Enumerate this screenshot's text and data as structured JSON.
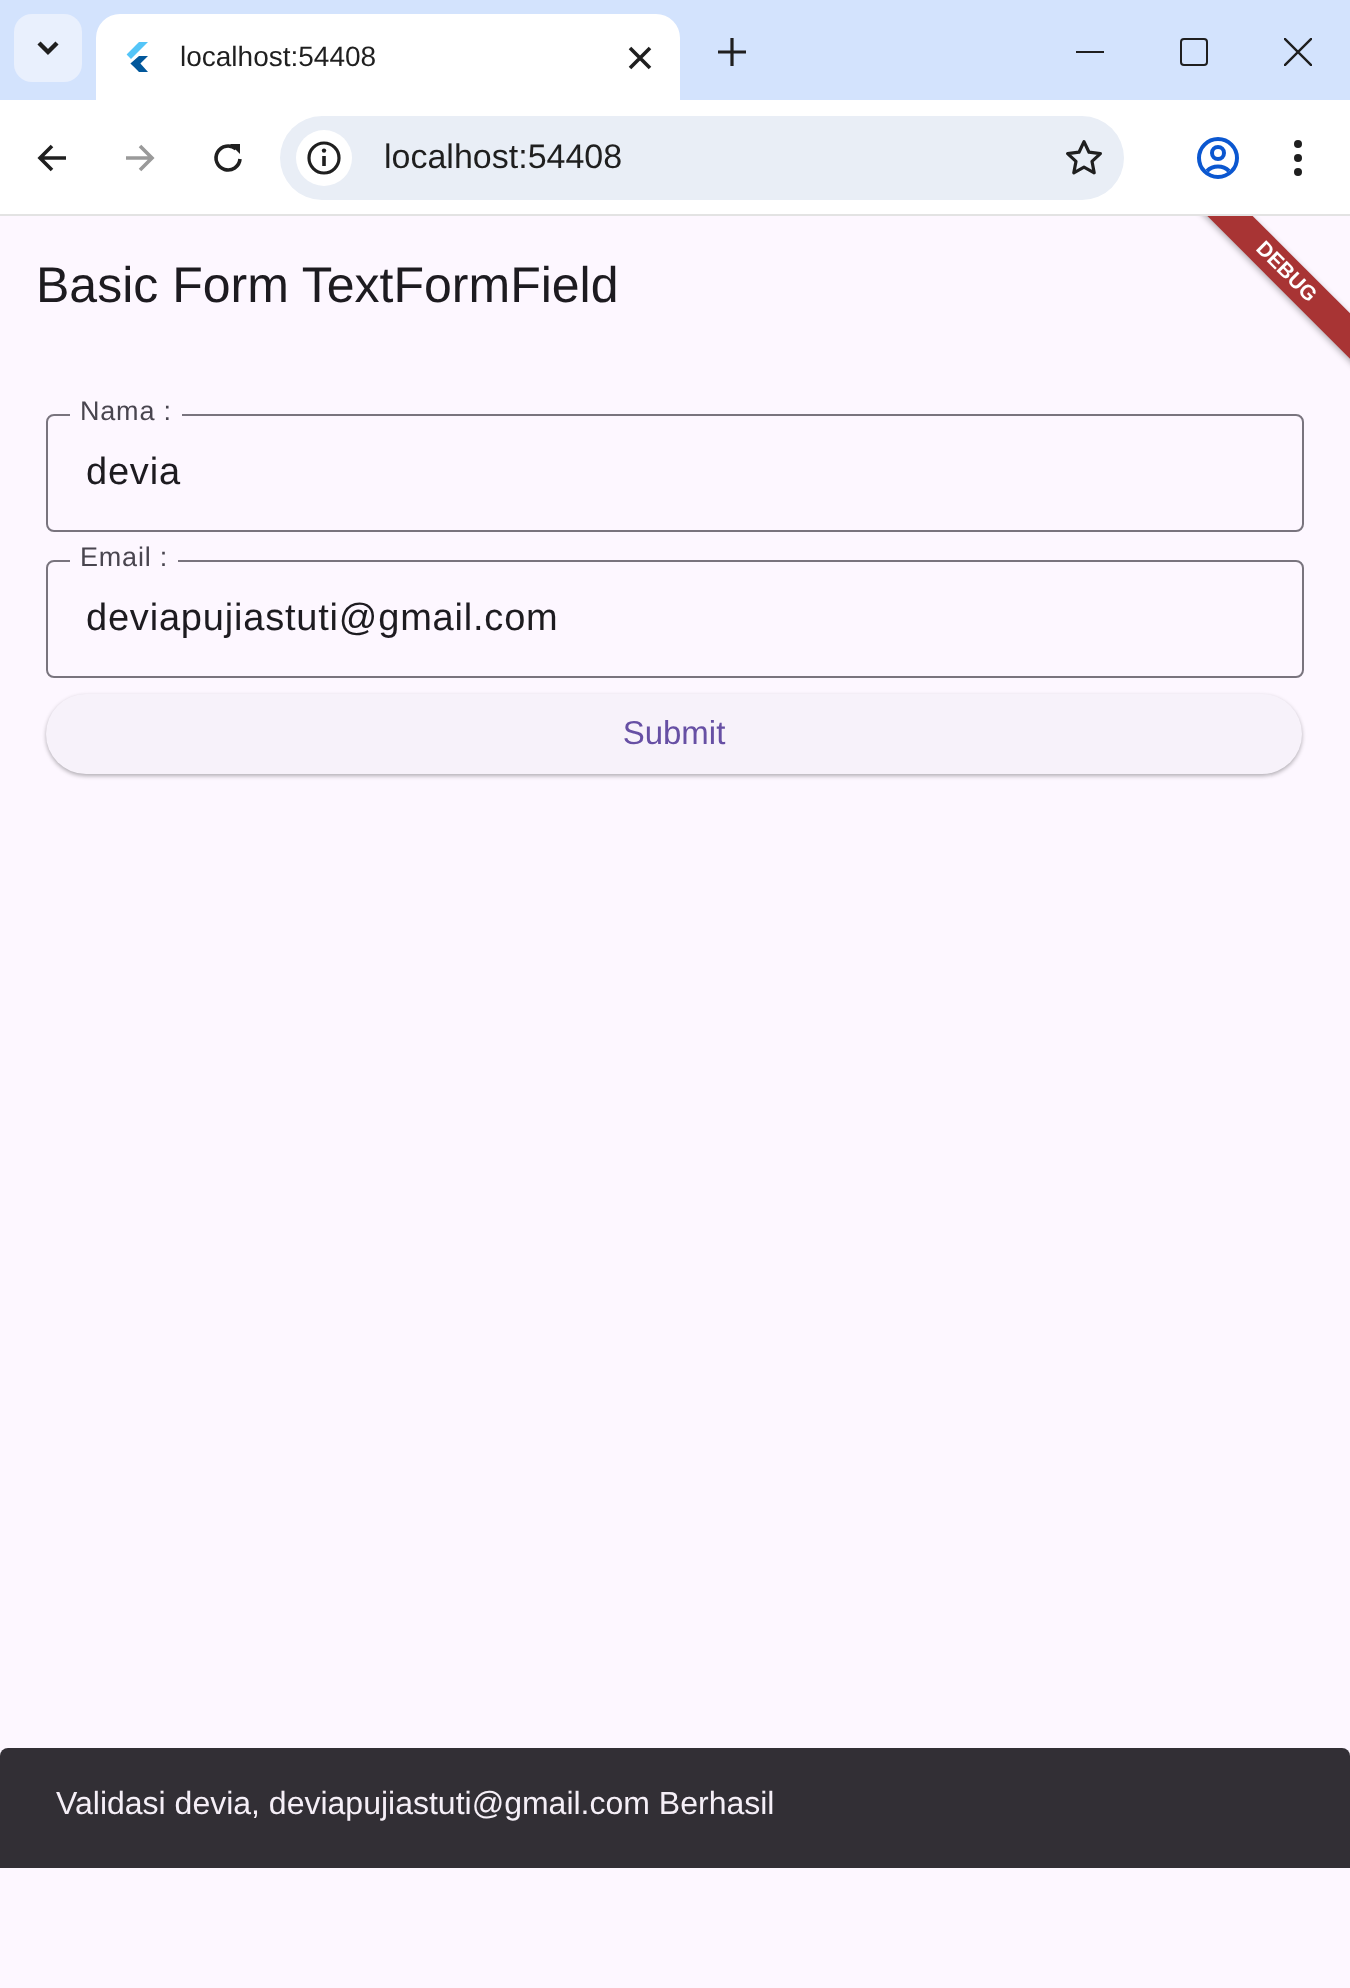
{
  "browser": {
    "tab_title": "localhost:54408",
    "url": "localhost:54408"
  },
  "page": {
    "title": "Basic Form TextFormField",
    "debug_banner": "DEBUG",
    "fields": [
      {
        "label": "Nama :",
        "value": "devia"
      },
      {
        "label": "Email :",
        "value": "deviapujiastuti@gmail.com"
      }
    ],
    "submit_button": "Submit"
  },
  "snackbar": {
    "message": "Validasi devia, deviapujiastuti@gmail.com Berhasil"
  }
}
